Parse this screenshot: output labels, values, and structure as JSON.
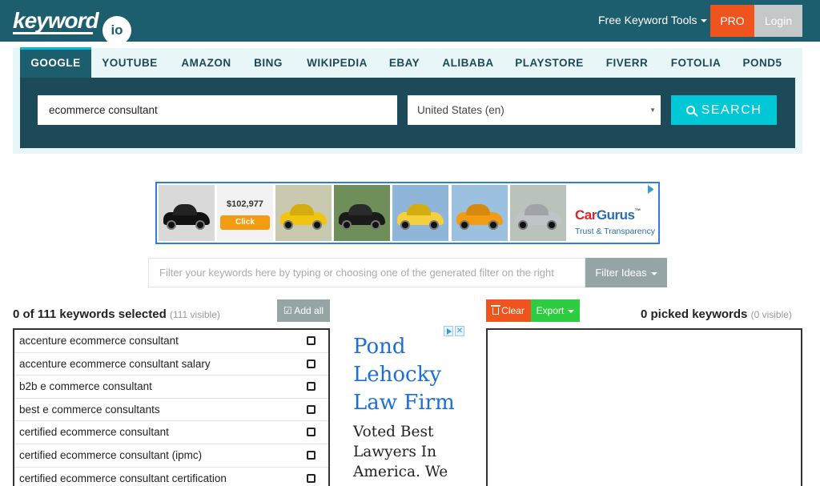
{
  "header": {
    "logo_word": "keyword",
    "logo_io": "io",
    "tools_label": "Free Keyword Tools",
    "pro_label": "PRO",
    "login_label": "Login"
  },
  "tabs": [
    {
      "label": "GOOGLE",
      "active": true
    },
    {
      "label": "YOUTUBE"
    },
    {
      "label": "AMAZON"
    },
    {
      "label": "BING"
    },
    {
      "label": "WIKIPEDIA"
    },
    {
      "label": "EBAY"
    },
    {
      "label": "ALIBABA"
    },
    {
      "label": "PLAYSTORE"
    },
    {
      "label": "FIVERR"
    },
    {
      "label": "FOTOLIA"
    },
    {
      "label": "POND5"
    }
  ],
  "search": {
    "keyword_value": "ecommerce consultant",
    "country_value": "United States (en)",
    "button_label": "SEARCH"
  },
  "banner_ad": {
    "price": "$102,977",
    "click_label": "Click",
    "brand_car": "Car",
    "brand_gurus": "Gurus",
    "brand_tm": "™",
    "tagline": "Trust & Transparency"
  },
  "filter": {
    "placeholder": "Filter your keywords here by typing or choosing one of the generated filter on the right",
    "button_label": "Filter Ideas"
  },
  "keywords_panel": {
    "title": "0 of 111 keywords selected",
    "visible_note": "(111 visible)",
    "add_all_label": "Add all",
    "items": [
      "accenture ecommerce consultant",
      "accenture ecommerce consultant salary",
      "b2b e commerce consultant",
      "best e commerce consultants",
      "certified ecommerce consultant",
      "certified ecommerce consultant (ipmc)",
      "certified ecommerce consultant certification"
    ]
  },
  "side_ad": {
    "title": "Pond Lehocky Law Firm",
    "body": "Voted Best Lawyers In America. We"
  },
  "picked_panel": {
    "clear_label": "Clear",
    "export_label": "Export",
    "title": "0 picked keywords",
    "visible_note": "(0 visible)"
  },
  "colors": {
    "header_bg": "#1d5e6e",
    "panel_bg": "#1c4a58",
    "accent_cyan": "#00c8d7",
    "pro_orange": "#f0541e",
    "export_green": "#2ecc40"
  }
}
